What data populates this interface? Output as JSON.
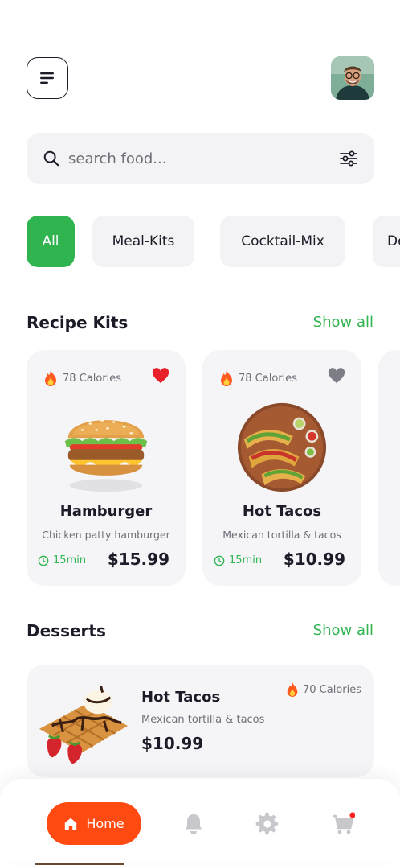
{
  "header": {
    "menu_icon": "menu-icon",
    "avatar_icon": "user-avatar"
  },
  "search": {
    "placeholder": "search food...",
    "search_icon": "search-icon",
    "filter_icon": "filter-sliders-icon"
  },
  "categories": [
    {
      "label": "All",
      "active": true
    },
    {
      "label": "Meal-Kits",
      "active": false
    },
    {
      "label": "Cocktail-Mix",
      "active": false
    },
    {
      "label": "De",
      "active": false
    }
  ],
  "recipe_kits": {
    "title": "Recipe Kits",
    "show_all": "Show all",
    "items": [
      {
        "calories": "78 Calories",
        "name": "Hamburger",
        "description": "Chicken patty hamburger",
        "time": "15min",
        "price": "$15.99",
        "favorite": true
      },
      {
        "calories": "78 Calories",
        "name": "Hot Tacos",
        "description": "Mexican tortilla & tacos",
        "time": "15min",
        "price": "$10.99",
        "favorite": false
      }
    ]
  },
  "desserts": {
    "title": "Desserts",
    "show_all": "Show all",
    "items": [
      {
        "calories": "70 Calories",
        "name": "Hot Tacos",
        "description": "Mexican tortilla & tacos",
        "price": "$10.99"
      }
    ]
  },
  "bottom_nav": {
    "home_label": "Home",
    "items": [
      "home-icon",
      "bell-icon",
      "settings-gear-icon",
      "cart-icon"
    ],
    "cart_has_badge": true
  },
  "colors": {
    "accent_green": "#2fb450",
    "accent_orange": "#ff4a12",
    "favorite_red": "#e8202a",
    "text_dark": "#1c1c28",
    "text_muted": "#6e6e78",
    "card_bg": "#f5f5f7"
  }
}
